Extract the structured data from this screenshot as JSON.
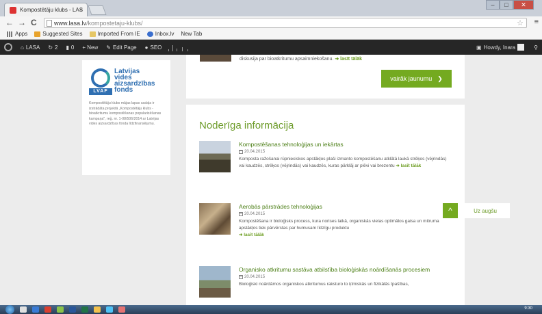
{
  "browser": {
    "tab_title": "Kompostētāju klubs - LAS",
    "tab_close": "×",
    "url_host": "www.lasa.lv",
    "url_path": "/kompostetaju-klubs/",
    "back": "←",
    "forward": "→",
    "reload": "C",
    "star": "☆",
    "menu": "≡"
  },
  "bookmarks": [
    {
      "label": "Apps",
      "icon": "apps-grid-icon"
    },
    {
      "label": "Suggested Sites",
      "icon": "suggested-sites-icon"
    },
    {
      "label": "Imported From IE",
      "icon": "folder-icon"
    },
    {
      "label": "Inbox.lv",
      "icon": "inbox-icon"
    },
    {
      "label": "New Tab",
      "icon": "page-icon"
    }
  ],
  "adminbar": {
    "site": "LASA",
    "updates": "2",
    "comments": "0",
    "new": "+ New",
    "edit": "Edit Page",
    "seo": "SEO",
    "howdy": "Howdy, Inara"
  },
  "sidebar": {
    "logo_lines": [
      "Latvijas",
      "vides",
      "aizsardzības",
      "fonds"
    ],
    "logo_abbr": "LVAF",
    "text": "Kompostētāju klubs mājas lapas sadaļa ir izstrādāta projektā „Kompostētāju klubs - bioatkritumu kompostēšanas popularizēšanas kampaņa\", reģ. nr. 1-08/506/2014 ar Latvijas vides aizsardzības fonda līdzfinansējumu."
  },
  "top_card": {
    "snippet": "diskusija par bioatkritumu apsaimniekošanu.",
    "read_more": "➜ lasīt tālāk",
    "more_button": "vairāk jaunumu",
    "more_arrow": "❯"
  },
  "info": {
    "section_title": "Noderīga informācija",
    "articles": [
      {
        "title": "Kompostēšanas tehnoloģijas un iekārtas",
        "date": "20.04.2015",
        "text": "Komposta ražošanai rūpnieciskos apstākļos plaši izmanto kompostēšanu atklātā laukā strēķos (vējrindās) vai kaudzēs, strēķos (vējrindās) vai kaudzēs, kuras pārklāj ar plēvi vai brezentu",
        "read_more": "➜ lasīt tālāk"
      },
      {
        "title": "Aerobās pārstrādes tehnoloģijas",
        "date": "20.04.2015",
        "text": "Kompostēšana ir bioloģisks process, kura norises laikā, organiskās vielas optimālos gaisa un mitruma apstākļos tiek pārvērstas par humusam līdzīgu produktu",
        "read_more": "➜ lasīt tālāk"
      },
      {
        "title": "Organisko atkritumu sastāva atbilstība bioloģiskās noārdīšanās procesiem",
        "date": "20.04.2015",
        "text": "Bioloģiski noārdāmos organiskos atkritumus raksturo to ķīmiskās un fizikālās īpašības,",
        "read_more": ""
      }
    ]
  },
  "to_top": {
    "icon": "^",
    "label": "Uz augšu"
  },
  "taskbar": {
    "clock": "9:30"
  },
  "colors": {
    "accent": "#74aa20",
    "title_green": "#6e9c2b",
    "adminbar": "#262626"
  }
}
